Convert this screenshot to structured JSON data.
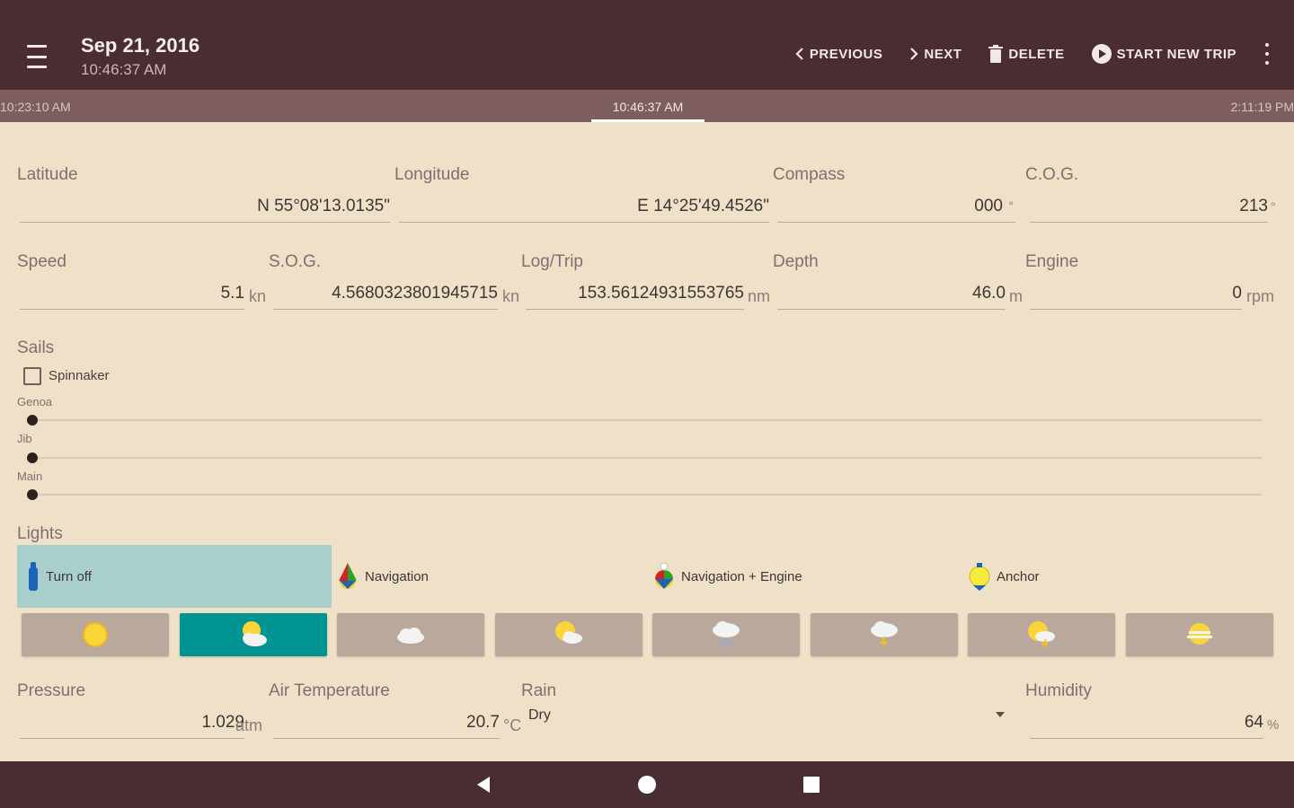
{
  "appbar": {
    "date": "Sep 21, 2016",
    "time": "10:46:37 AM",
    "actions": {
      "previous": "PREVIOUS",
      "next": "NEXT",
      "delete": "DELETE",
      "start_new_trip": "START NEW TRIP"
    }
  },
  "timeline": {
    "start": "10:23:10 AM",
    "current": "10:46:37 AM",
    "end": "2:11:19 PM"
  },
  "position": {
    "latitude_label": "Latitude",
    "latitude": "N 55°08'13.0135\"",
    "longitude_label": "Longitude",
    "longitude": "E 14°25'49.4526\"",
    "compass_label": "Compass",
    "compass": "000",
    "compass_unit": "°",
    "cog_label": "C.O.G.",
    "cog": "213",
    "cog_unit": "°"
  },
  "motion": {
    "speed_label": "Speed",
    "speed": "5.1",
    "speed_unit": "kn",
    "sog_label": "S.O.G.",
    "sog": "4.5680323801945715",
    "sog_unit": "kn",
    "log_label": "Log/Trip",
    "log": "153.56124931553765",
    "log_unit": "nm",
    "depth_label": "Depth",
    "depth": "46.0",
    "depth_unit": "m",
    "engine_label": "Engine",
    "engine": "0",
    "engine_unit": "rpm"
  },
  "sails": {
    "title": "Sails",
    "spinnaker_label": "Spinnaker",
    "spinnaker_checked": false,
    "genoa_label": "Genoa",
    "genoa_level": 0,
    "jib_label": "Jib",
    "jib_level": 0,
    "main_label": "Main",
    "main_level": 0
  },
  "lights": {
    "title": "Lights",
    "options": [
      {
        "label": "Turn off",
        "icon": "bulb-off-icon",
        "selected": true
      },
      {
        "label": "Navigation",
        "icon": "navigation-lights-icon",
        "selected": false
      },
      {
        "label": "Navigation + Engine",
        "icon": "navigation-engine-lights-icon",
        "selected": false
      },
      {
        "label": "Anchor",
        "icon": "anchor-light-icon",
        "selected": false
      }
    ]
  },
  "weather": {
    "options": [
      {
        "icon": "sun-icon",
        "selected": false
      },
      {
        "icon": "partly-cloudy-icon",
        "selected": true
      },
      {
        "icon": "cloud-icon",
        "selected": false
      },
      {
        "icon": "sun-cloud-icon",
        "selected": false
      },
      {
        "icon": "rain-cloud-icon",
        "selected": false
      },
      {
        "icon": "thunderstorm-icon",
        "selected": false
      },
      {
        "icon": "sun-thunder-icon",
        "selected": false
      },
      {
        "icon": "fog-sun-icon",
        "selected": false
      }
    ],
    "colors": {
      "selected": "#009591",
      "default": "#bba89d"
    }
  },
  "conditions": {
    "pressure_label": "Pressure",
    "pressure": "1.029",
    "pressure_unit": "atm",
    "air_temp_label": "Air Temperature",
    "air_temp": "20.7",
    "air_temp_unit": "°C",
    "rain_label": "Rain",
    "rain": "Dry",
    "humidity_label": "Humidity",
    "humidity": "64",
    "humidity_unit": "%"
  }
}
